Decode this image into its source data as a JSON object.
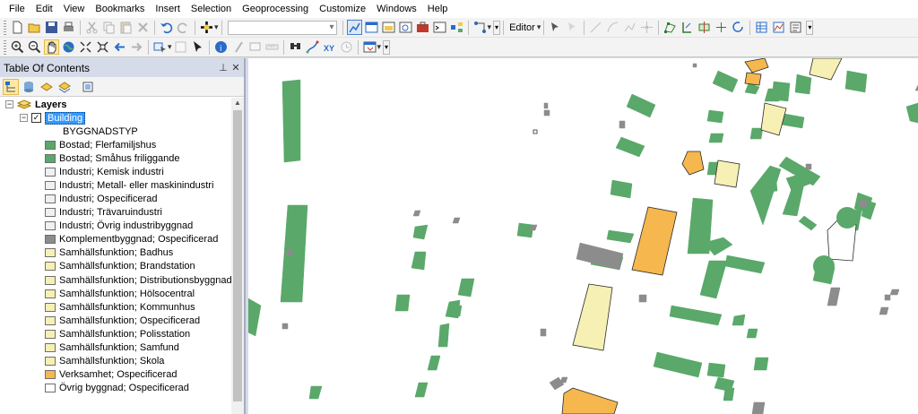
{
  "menu": {
    "items": [
      "File",
      "Edit",
      "View",
      "Bookmarks",
      "Insert",
      "Selection",
      "Geoprocessing",
      "Customize",
      "Windows",
      "Help"
    ]
  },
  "toolbar": {
    "editor_label": "Editor",
    "scale_value": ""
  },
  "toc": {
    "title": "Table Of Contents",
    "pin_icon": "pin-icon",
    "close_icon": "close-icon",
    "layers_label": "Layers",
    "layer_name": "Building",
    "field_name": "BYGGNADSTYP",
    "legend": [
      {
        "label": "Bostad; Flerfamiljshus",
        "color": "#5aa86a"
      },
      {
        "label": "Bostad; Småhus friliggande",
        "color": "#5aa86a"
      },
      {
        "label": "Industri; Kemisk industri",
        "color": "#f0f0f0"
      },
      {
        "label": "Industri; Metall- eller maskinindustri",
        "color": "#f0f0f0"
      },
      {
        "label": "Industri; Ospecificerad",
        "color": "#f0f0f0"
      },
      {
        "label": "Industri; Trävaruindustri",
        "color": "#f0f0f0"
      },
      {
        "label": "Industri; Övrig industribyggnad",
        "color": "#f0f0f0"
      },
      {
        "label": "Komplementbyggnad; Ospecificerad",
        "color": "#8c8c8c"
      },
      {
        "label": "Samhällsfunktion; Badhus",
        "color": "#f7f0b4"
      },
      {
        "label": "Samhällsfunktion; Brandstation",
        "color": "#f7f0b4"
      },
      {
        "label": "Samhällsfunktion; Distributionsbyggnad",
        "color": "#f7f0b4"
      },
      {
        "label": "Samhällsfunktion; Hölsocentral",
        "color": "#f7f0b4"
      },
      {
        "label": "Samhällsfunktion; Kommunhus",
        "color": "#f7f0b4"
      },
      {
        "label": "Samhällsfunktion; Ospecificerad",
        "color": "#f7f0b4"
      },
      {
        "label": "Samhällsfunktion; Polisstation",
        "color": "#f7f0b4"
      },
      {
        "label": "Samhällsfunktion; Samfund",
        "color": "#f7f0b4"
      },
      {
        "label": "Samhällsfunktion; Skola",
        "color": "#f7f0b4"
      },
      {
        "label": "Verksamhet; Ospecificerad",
        "color": "#f5b74e"
      },
      {
        "label": "Övrig byggnad; Ospecificerad",
        "color": "#ffffff"
      }
    ]
  },
  "map": {
    "colors": {
      "residential": "#5aa86a",
      "outbuilding": "#8c8c8c",
      "public": "#f7f0b4",
      "business": "#f5b74e",
      "other": "#ffffff"
    }
  }
}
